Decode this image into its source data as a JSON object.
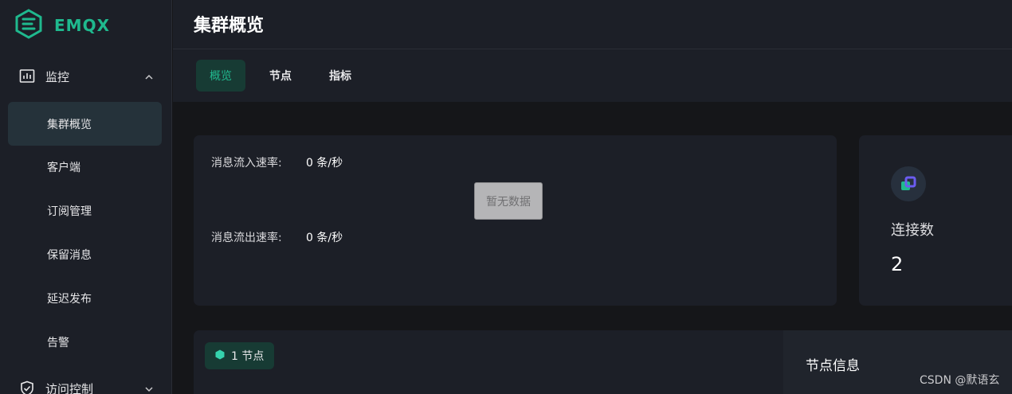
{
  "app": {
    "logo_text": "EMQX"
  },
  "sidebar": {
    "groups": [
      {
        "label": "监控",
        "icon": "chart-icon",
        "expanded": true
      },
      {
        "label": "访问控制",
        "icon": "shield-icon",
        "expanded": false
      }
    ],
    "items": [
      {
        "label": "集群概览",
        "active": true
      },
      {
        "label": "客户端"
      },
      {
        "label": "订阅管理"
      },
      {
        "label": "保留消息"
      },
      {
        "label": "延迟发布"
      },
      {
        "label": "告警"
      }
    ]
  },
  "header": {
    "title": "集群概览"
  },
  "tabs": [
    {
      "label": "概览",
      "active": true
    },
    {
      "label": "节点"
    },
    {
      "label": "指标"
    }
  ],
  "rates": {
    "in_label": "消息流入速率:",
    "in_value": "0 条/秒",
    "out_label": "消息流出速率:",
    "out_value": "0 条/秒",
    "no_data": "暂无数据"
  },
  "connections": {
    "label": "连接数",
    "value": "2"
  },
  "nodes": {
    "badge": "1 节点",
    "info_title": "节点信息"
  },
  "watermark": "CSDN @默语玄",
  "colors": {
    "accent": "#1fb98e",
    "background": "#151619",
    "panel": "#1c1f27",
    "active_tab_bg": "#173b34"
  }
}
